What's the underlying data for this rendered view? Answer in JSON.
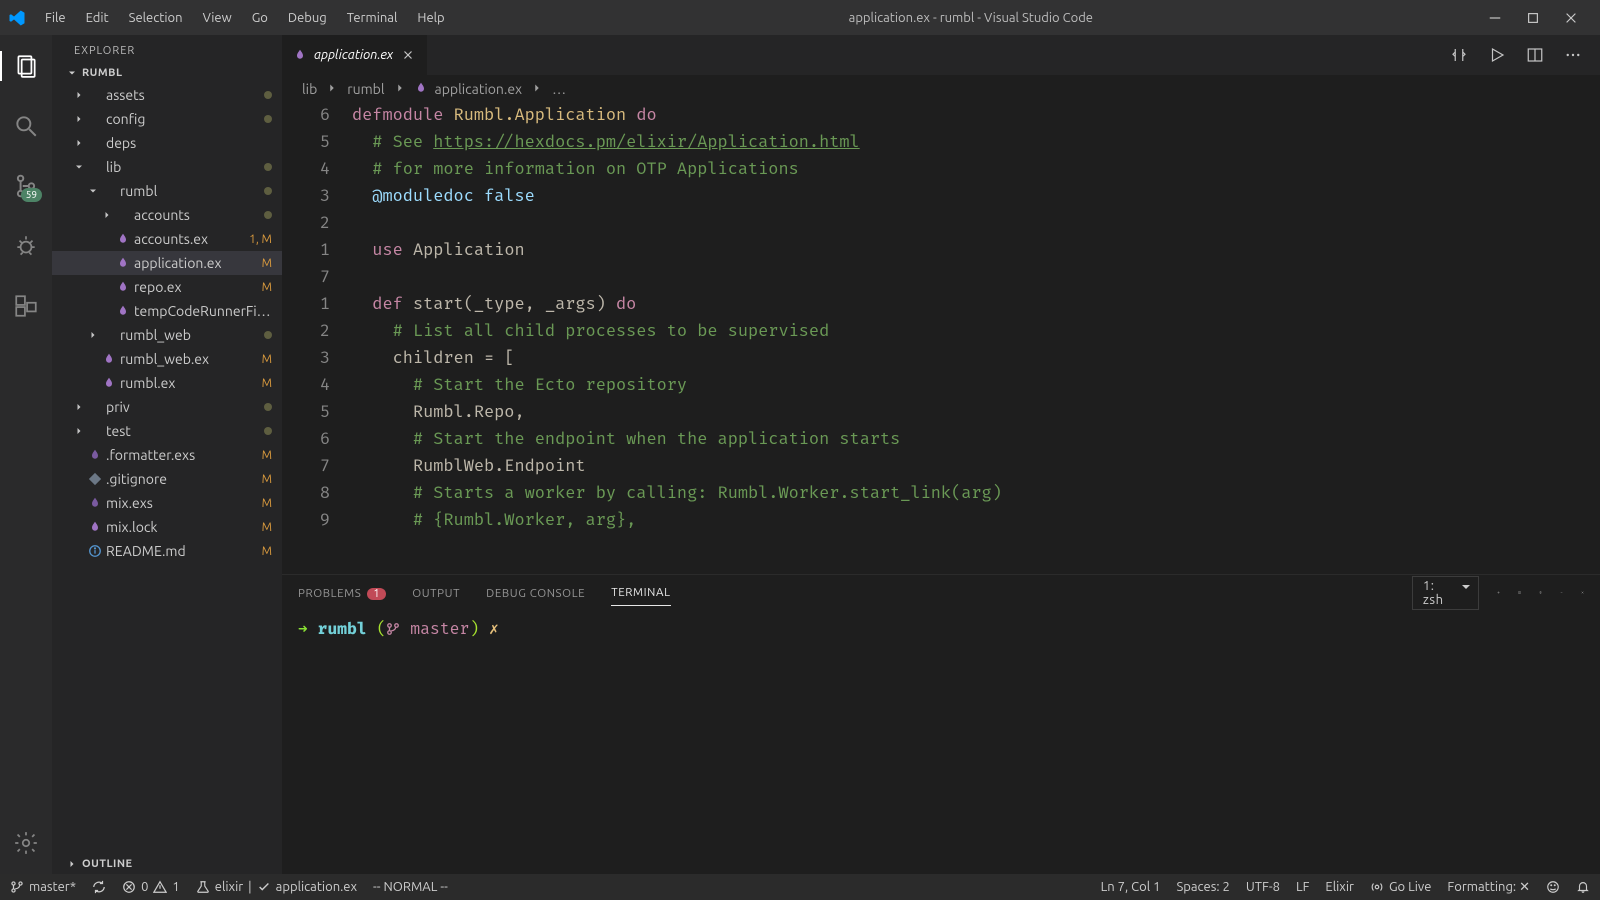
{
  "window": {
    "title": "application.ex - rumbl - Visual Studio Code"
  },
  "menu": [
    "File",
    "Edit",
    "Selection",
    "View",
    "Go",
    "Debug",
    "Terminal",
    "Help"
  ],
  "sidebar": {
    "title": "EXPLORER",
    "section": "RUMBL",
    "outline": "OUTLINE",
    "scmBadge": "59",
    "items": [
      {
        "label": "assets",
        "kind": "folder",
        "depth": 1,
        "badge": "",
        "dot": true,
        "open": false
      },
      {
        "label": "config",
        "kind": "folder",
        "depth": 1,
        "badge": "",
        "dot": true,
        "open": false
      },
      {
        "label": "deps",
        "kind": "folder",
        "depth": 1,
        "badge": "",
        "dot": false,
        "open": false
      },
      {
        "label": "lib",
        "kind": "folder",
        "depth": 1,
        "badge": "",
        "dot": true,
        "open": true
      },
      {
        "label": "rumbl",
        "kind": "folder",
        "depth": 2,
        "badge": "",
        "dot": true,
        "open": true
      },
      {
        "label": "accounts",
        "kind": "folder",
        "depth": 3,
        "badge": "",
        "dot": true,
        "open": false
      },
      {
        "label": "accounts.ex",
        "kind": "elixir",
        "depth": 3,
        "badge": "1, M",
        "dot": false
      },
      {
        "label": "application.ex",
        "kind": "elixir",
        "depth": 3,
        "badge": "M",
        "dot": false,
        "active": true
      },
      {
        "label": "repo.ex",
        "kind": "elixir",
        "depth": 3,
        "badge": "M",
        "dot": false
      },
      {
        "label": "tempCodeRunnerFil…",
        "kind": "elixir",
        "depth": 3,
        "badge": "",
        "dot": false
      },
      {
        "label": "rumbl_web",
        "kind": "folder",
        "depth": 2,
        "badge": "",
        "dot": true,
        "open": false
      },
      {
        "label": "rumbl_web.ex",
        "kind": "elixir",
        "depth": 2,
        "badge": "M",
        "dot": false
      },
      {
        "label": "rumbl.ex",
        "kind": "elixir",
        "depth": 2,
        "badge": "M",
        "dot": false
      },
      {
        "label": "priv",
        "kind": "folder",
        "depth": 1,
        "badge": "",
        "dot": true,
        "open": false
      },
      {
        "label": "test",
        "kind": "folder",
        "depth": 1,
        "badge": "",
        "dot": true,
        "open": false
      },
      {
        "label": ".formatter.exs",
        "kind": "elixir2",
        "depth": 1,
        "badge": "M",
        "dot": false
      },
      {
        "label": ".gitignore",
        "kind": "git",
        "depth": 1,
        "badge": "M",
        "dot": false
      },
      {
        "label": "mix.exs",
        "kind": "elixir2",
        "depth": 1,
        "badge": "M",
        "dot": false
      },
      {
        "label": "mix.lock",
        "kind": "elixir",
        "depth": 1,
        "badge": "M",
        "dot": false
      },
      {
        "label": "README.md",
        "kind": "info",
        "depth": 1,
        "badge": "M",
        "dot": false
      }
    ]
  },
  "tabs": [
    {
      "label": "application.ex"
    }
  ],
  "breadcrumb": [
    "lib",
    "rumbl",
    "application.ex",
    "…"
  ],
  "gutter": [
    "6",
    "5",
    "4",
    "3",
    "2",
    "1",
    "7",
    "1",
    "2",
    "3",
    "4",
    "5",
    "6",
    "7",
    "8",
    "9"
  ],
  "code": {
    "l1a": "defmodule ",
    "l1b": "Rumbl.Application ",
    "l1c": "do",
    "l2a": "  # See ",
    "l2b": "https://hexdocs.pm/elixir/Application.html",
    "l3": "  # for more information on OTP Applications",
    "l4": "  @moduledoc false",
    "l5": "",
    "l6a": "  use ",
    "l6b": "Application",
    "l7": "",
    "l8a": "  def ",
    "l8b": "start",
    "l8c": "(_type, _args) ",
    "l8d": "do",
    "l9": "    # List all child processes to be supervised",
    "l10": "    children = [",
    "l11": "      # Start the Ecto repository",
    "l12": "      Rumbl.Repo,",
    "l13": "      # Start the endpoint when the application starts",
    "l14": "      RumblWeb.Endpoint",
    "l15": "      # Starts a worker by calling: Rumbl.Worker.start_link(arg)",
    "l16": "      # {Rumbl.Worker, arg},"
  },
  "panel": {
    "tabs": {
      "problems": "PROBLEMS",
      "problemsCount": "1",
      "output": "OUTPUT",
      "debug": "DEBUG CONSOLE",
      "terminal": "TERMINAL"
    },
    "termSelect": "1: zsh",
    "prompt": {
      "arrow": "➜ ",
      "dir": "rumbl ",
      "open": "(",
      "branchIcon": "",
      "branch": "master",
      "close": ")",
      "x": " ✗"
    }
  },
  "status": {
    "branch": "master*",
    "errors": "0",
    "warnings": "1",
    "lang": "elixir",
    "file": "application.ex",
    "mode": "-- NORMAL --",
    "pos": "Ln 7, Col 1",
    "spaces": "Spaces: 2",
    "enc": "UTF-8",
    "eol": "LF",
    "syntax": "Elixir",
    "golive": "Go Live",
    "formatting": "Formatting: ✕"
  }
}
